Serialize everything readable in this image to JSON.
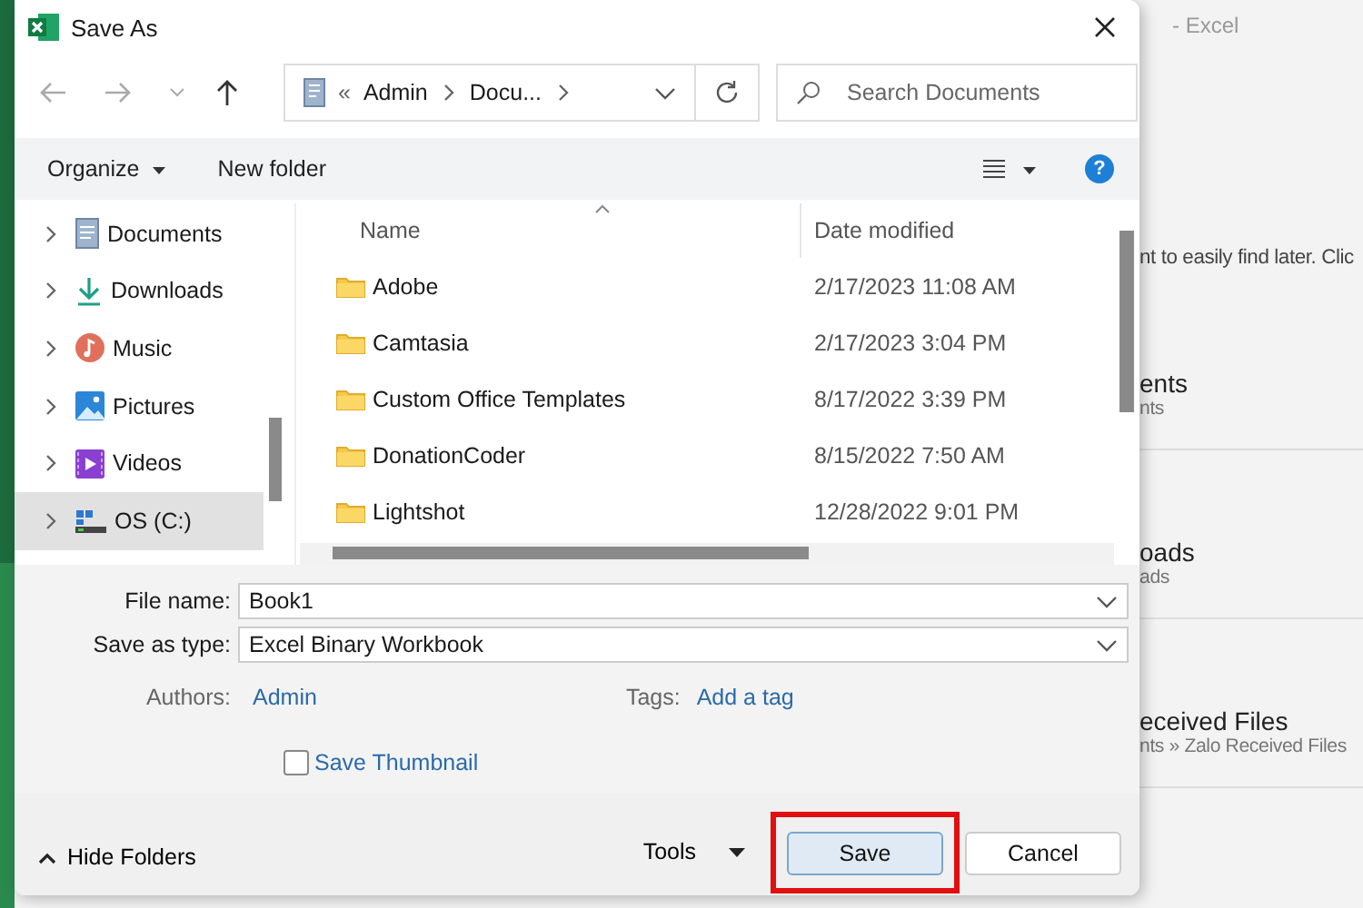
{
  "backstage": {
    "title": "- Excel",
    "hint": "nt to easily find later. Clic",
    "places": [
      {
        "name": "ents",
        "path": "nts"
      },
      {
        "name": "oads",
        "path": "ads"
      },
      {
        "name": "eceived Files",
        "path": "nts » Zalo Received Files"
      }
    ]
  },
  "dialog": {
    "title": "Save As",
    "address": {
      "overflow": "«",
      "segments": [
        "Admin",
        "Docu..."
      ]
    },
    "search": {
      "placeholder": "Search Documents"
    },
    "toolbar": {
      "organize": "Organize",
      "new_folder": "New folder",
      "help": "?"
    },
    "nav_pane": [
      {
        "label": "Documents",
        "kind": "documents",
        "selected": false
      },
      {
        "label": "Downloads",
        "kind": "downloads",
        "selected": false
      },
      {
        "label": "Music",
        "kind": "music",
        "selected": false
      },
      {
        "label": "Pictures",
        "kind": "pictures",
        "selected": false
      },
      {
        "label": "Videos",
        "kind": "videos",
        "selected": false
      },
      {
        "label": "OS (C:)",
        "kind": "drive",
        "selected": true
      }
    ],
    "file_list": {
      "columns": [
        "Name",
        "Date modified"
      ],
      "rows": [
        {
          "name": "Adobe",
          "date": "2/17/2023 11:08 AM"
        },
        {
          "name": "Camtasia",
          "date": "2/17/2023 3:04 PM"
        },
        {
          "name": "Custom Office Templates",
          "date": "8/17/2022 3:39 PM"
        },
        {
          "name": "DonationCoder",
          "date": "8/15/2022 7:50 AM"
        },
        {
          "name": "Lightshot",
          "date": "12/28/2022 9:01 PM"
        }
      ]
    },
    "form": {
      "file_name": {
        "label": "File name:",
        "value": "Book1"
      },
      "save_as_type": {
        "label": "Save as type:",
        "value": "Excel Binary Workbook"
      },
      "authors": {
        "label": "Authors:",
        "value": "Admin"
      },
      "tags": {
        "label": "Tags:",
        "value": "Add a tag"
      },
      "thumbnail": {
        "label": "Save Thumbnail",
        "checked": false
      }
    },
    "footer": {
      "hide_folders": "Hide Folders",
      "tools": "Tools",
      "buttons": [
        {
          "label": "Save",
          "default": true,
          "highlighted": true
        },
        {
          "label": "Cancel",
          "default": false,
          "highlighted": false
        }
      ]
    }
  }
}
